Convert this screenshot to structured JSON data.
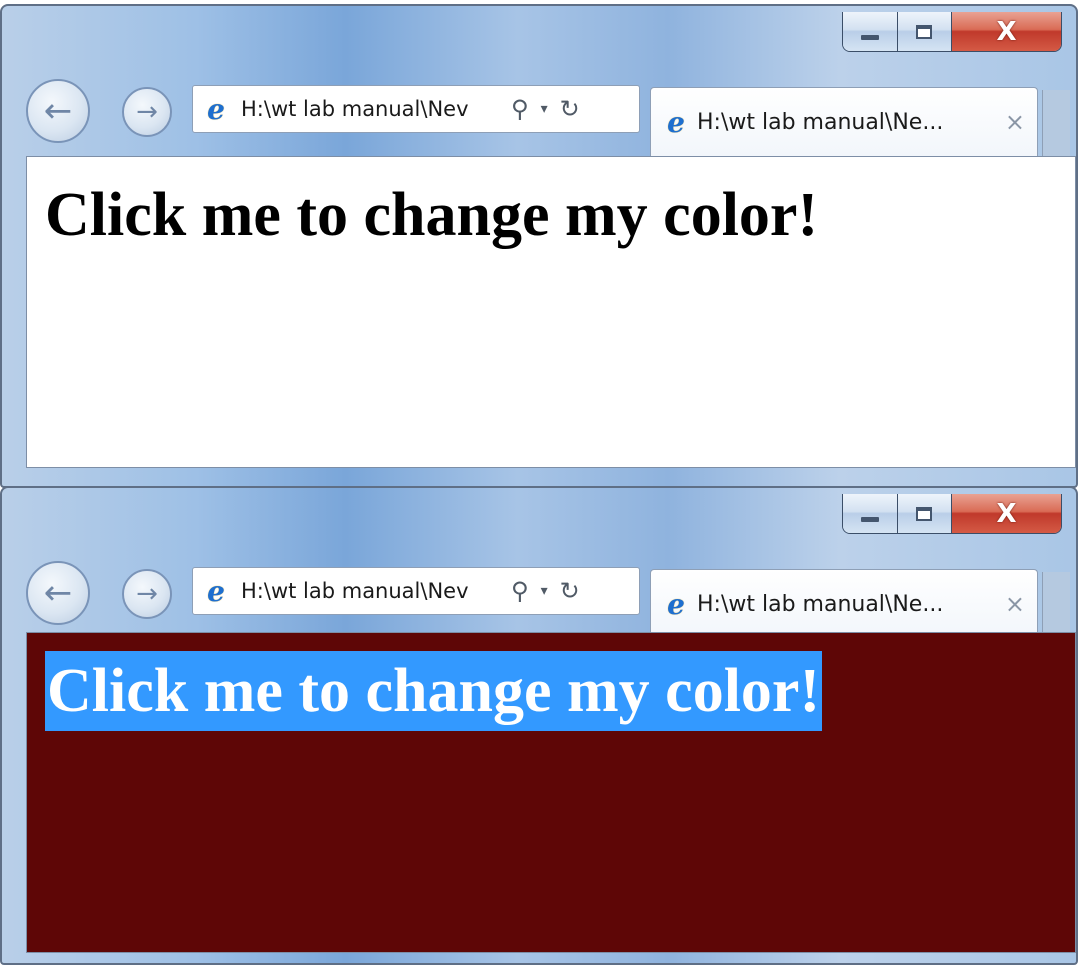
{
  "windows": [
    {
      "address": "H:\\wt lab manual\\Nev",
      "tab_title": "H:\\wt lab manual\\Ne...",
      "heading": "Click me to change my color!",
      "page_background": "#ffffff",
      "heading_color": "#000000",
      "heading_selected": false
    },
    {
      "address": "H:\\wt lab manual\\Nev",
      "tab_title": "H:\\wt lab manual\\Ne...",
      "heading": "Click me to change my color!",
      "page_background": "#5e0606",
      "heading_color": "#ffffff",
      "heading_selection_color": "#3399ff",
      "heading_selected": true
    }
  ],
  "icons": {
    "back": "←",
    "forward": "→",
    "browser": "e",
    "search": "⚲",
    "dropdown": "▾",
    "refresh": "↻",
    "tab_close": "×",
    "window_close": "X"
  }
}
